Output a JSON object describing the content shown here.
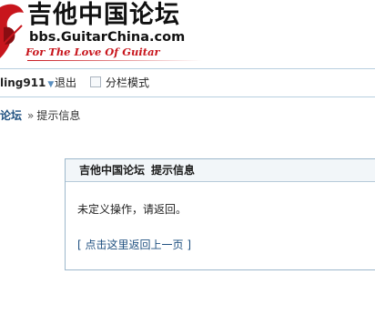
{
  "header": {
    "site_title": "吉他中国论坛",
    "site_url": "bbs.GuitarChina.com",
    "slogan": "For The Love Of Guitar",
    "brand_color": "#c8161d"
  },
  "userbar": {
    "username": "ling911",
    "dropdown_icon": "chevron-down-icon",
    "logout_label": "退出",
    "split_mode_label": "分栏模式"
  },
  "breadcrumb": {
    "forum_label": "论坛",
    "separator": "»",
    "current_label": "提示信息"
  },
  "message": {
    "title_site": "吉他中国论坛",
    "title_label": "提示信息",
    "body": "未定义操作，请返回。",
    "link_open": "[",
    "link_label": "点击这里返回上一页",
    "link_close": "]"
  }
}
